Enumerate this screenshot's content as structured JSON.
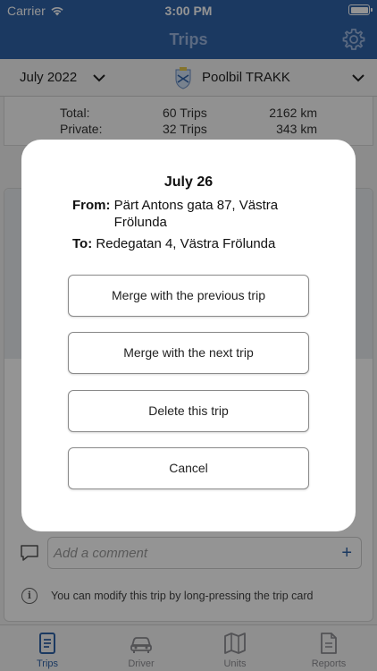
{
  "status_bar": {
    "carrier": "Carrier",
    "time": "3:00 PM"
  },
  "nav": {
    "title": "Trips",
    "settings_icon": "gear-icon"
  },
  "selector": {
    "month": "July 2022",
    "car": "Poolbil TRAKK"
  },
  "summary": {
    "rows": [
      {
        "label": "Total:",
        "trips": "60 Trips",
        "distance": "2162 km"
      },
      {
        "label": "Private:",
        "trips": "32 Trips",
        "distance": "343 km"
      }
    ]
  },
  "comment": {
    "placeholder": "Add a comment",
    "add_icon": "+"
  },
  "hint": "You can modify this trip by long-pressing the trip card",
  "tabs": [
    {
      "label": "Trips",
      "icon": "document-icon",
      "active": true
    },
    {
      "label": "Driver",
      "icon": "car-icon",
      "active": false
    },
    {
      "label": "Units",
      "icon": "map-icon",
      "active": false
    },
    {
      "label": "Reports",
      "icon": "report-icon",
      "active": false
    }
  ],
  "modal": {
    "date": "July 26",
    "from_label": "From:",
    "from_value": "Pärt Antons gata 87, Västra Frölunda",
    "to_label": "To:",
    "to_value": "Redegatan 4, Västra Frölunda",
    "buttons": {
      "merge_previous": "Merge with the previous trip",
      "merge_next": "Merge with the next trip",
      "delete": "Delete this trip",
      "cancel": "Cancel"
    }
  },
  "colors": {
    "primary": "#2f62a8",
    "nav_title": "#9bb6de"
  }
}
